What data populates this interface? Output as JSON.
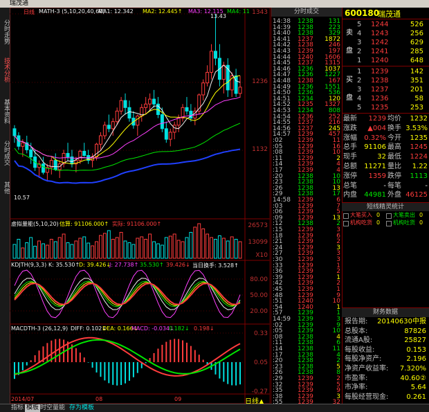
{
  "window": {
    "title": "瑞茂通"
  },
  "side_tabs": [
    "分时走势",
    "技术分析",
    "基本资料",
    "分时成交",
    "其他"
  ],
  "main_chart": {
    "label": "日线",
    "ma_header": "MATH-3 (5,10,20,40,60)",
    "ma1": "MA1: 12.342",
    "ma2": "MA2: 12.445↑",
    "ma3": "MA3: 12.115",
    "ma4": "MA4: 11",
    "price_high_label": "13.43",
    "price_low_label": "10.57",
    "axis": [
      "1343",
      "1236",
      "1132"
    ]
  },
  "volume_panel": {
    "header": "虚拟量能(5,10,20)",
    "estimate": "估算: 91106.000↑",
    "actual": "实际: 91106.000↑",
    "axis": [
      "26573",
      "13099",
      "X10"
    ]
  },
  "kdj_panel": {
    "header": "KDJTH(9,3,3)",
    "k": "K: 35.530↑",
    "d": "D: 39.426↓",
    "j": "J: 27.738↑",
    "extra1": "35.530↑",
    "extra2": "39.426↓",
    "turnover": "当日换手: 3.528↑",
    "axis": [
      "80.00",
      "50.00",
      "20.00"
    ]
  },
  "macd_panel": {
    "header": "MACDTH-3 (26,12,9)",
    "diff": "DIFF: 0.102↓",
    "dea": "DEA: 0.166↓",
    "macd": "MACD: -0.034↓",
    "extra1": "0.182↓",
    "extra2": "0.198↓",
    "axis": [
      "0.33",
      "0.05",
      "-0.27"
    ]
  },
  "date_axis": [
    "2014/07",
    "08",
    "09"
  ],
  "period_button": "日线▲",
  "bottom_tabs": [
    "指标",
    "模板",
    "时空量能",
    "存为模板"
  ],
  "ticks_panel": {
    "title": "分时成交",
    "rows": [
      {
        "t": "14:38",
        "p": "1238",
        "d": "down",
        "v": "131"
      },
      {
        "t": "14:39",
        "p": "1238",
        "d": "down",
        "v": "223"
      },
      {
        "t": "14:40",
        "p": "1238",
        "d": "down",
        "v": "329"
      },
      {
        "t": "14:41",
        "p": "1237",
        "d": "up",
        "v": "1872"
      },
      {
        "t": "14:42",
        "p": "1238",
        "d": "up",
        "v": "246"
      },
      {
        "t": "14:43",
        "p": "1239",
        "d": "up",
        "v": "197"
      },
      {
        "t": "14:44",
        "p": "1240",
        "d": "up",
        "v": "1606"
      },
      {
        "t": "14:45",
        "p": "1237",
        "d": "up",
        "v": "1315"
      },
      {
        "t": "14:46",
        "p": "1236",
        "d": "down",
        "v": "1037"
      },
      {
        "t": "14:47",
        "p": "1236",
        "d": "down",
        "v": "1227"
      },
      {
        "t": "14:48",
        "p": "1238",
        "d": "up",
        "v": "167"
      },
      {
        "t": "14:49",
        "p": "1236",
        "d": "down",
        "v": "1551"
      },
      {
        "t": "14:50",
        "p": "1236",
        "d": "down",
        "v": "536"
      },
      {
        "t": "14:51",
        "p": "1234",
        "d": "down",
        "v": "120"
      },
      {
        "t": "14:52",
        "p": "1235",
        "d": "up",
        "v": "1327"
      },
      {
        "t": "14:53",
        "p": "1234",
        "d": "down",
        "v": "808"
      },
      {
        "t": "14:54",
        "p": "1236",
        "d": "up",
        "v": "252"
      },
      {
        "t": "14:55",
        "p": "1237",
        "d": "up",
        "v": "216"
      },
      {
        "t": "14:56",
        "p": "1237",
        "d": "up",
        "v": "245"
      },
      {
        "t": "14:57",
        "p": "1239",
        "d": "up",
        "v": "457"
      },
      {
        "t": ":02",
        "p": "1239",
        "d": "up",
        "v": "11"
      },
      {
        "t": ":05",
        "p": "1239",
        "d": "up",
        "v": "16"
      },
      {
        "t": ":08",
        "p": "1239",
        "d": "up",
        "v": "10"
      },
      {
        "t": ":11",
        "p": "1239",
        "d": "up",
        "v": "2"
      },
      {
        "t": ":14",
        "p": "1239",
        "d": "up",
        "v": "4"
      },
      {
        "t": ":17",
        "p": "1239",
        "d": "up",
        "v": "4"
      },
      {
        "t": ":20",
        "p": "1238",
        "d": "down",
        "v": "10"
      },
      {
        "t": ":23",
        "p": "1238",
        "d": "down",
        "v": "10"
      },
      {
        "t": ":26",
        "p": "1238",
        "d": "down",
        "v": "13"
      },
      {
        "t": ":29",
        "p": "1238",
        "d": "down",
        "v": "17"
      },
      {
        "t": "14:58",
        "p": "1239",
        "d": "up",
        "v": "6"
      },
      {
        "t": ":03",
        "p": "1239",
        "d": "up",
        "v": "7"
      },
      {
        "t": ":06",
        "p": "1239",
        "d": "up",
        "v": "5"
      },
      {
        "t": ":09",
        "p": "1239",
        "d": "up",
        "v": "13"
      },
      {
        "t": ":12",
        "p": "1238",
        "d": "down",
        "v": "2"
      },
      {
        "t": ":15",
        "p": "1239",
        "d": "up",
        "v": "3"
      },
      {
        "t": ":18",
        "p": "1239",
        "d": "up",
        "v": "6"
      },
      {
        "t": ":21",
        "p": "1239",
        "d": "up",
        "v": "2"
      },
      {
        "t": ":24",
        "p": "1239",
        "d": "up",
        "v": "3"
      },
      {
        "t": ":27",
        "p": "1239",
        "d": "up",
        "v": "3"
      },
      {
        "t": ":30",
        "p": "1239",
        "d": "up",
        "v": "3"
      },
      {
        "t": ":33",
        "p": "1239",
        "d": "up",
        "v": "1"
      },
      {
        "t": ":36",
        "p": "1239",
        "d": "up",
        "v": "2"
      },
      {
        "t": ":39",
        "p": "1239",
        "d": "up",
        "v": "1"
      },
      {
        "t": ":42",
        "p": "1239",
        "d": "up",
        "v": "2"
      },
      {
        "t": ":45",
        "p": "1239",
        "d": "up",
        "v": "1"
      },
      {
        "t": ":48",
        "p": "1239",
        "d": "up",
        "v": "9"
      },
      {
        "t": ":51",
        "p": "1240",
        "d": "up",
        "v": "10"
      },
      {
        "t": ":54",
        "p": "1240",
        "d": "up",
        "v": "1"
      },
      {
        "t": ":57",
        "p": "1239",
        "d": "down",
        "v": "1"
      },
      {
        "t": "14:59",
        "p": "1239",
        "d": "down",
        "v": "3"
      },
      {
        "t": ":02",
        "p": "1239",
        "d": "down",
        "v": "9"
      },
      {
        "t": ":05",
        "p": "1239",
        "d": "down",
        "v": "10"
      },
      {
        "t": ":08",
        "p": "1238",
        "d": "down",
        "v": "4"
      },
      {
        "t": ":11",
        "p": "1238",
        "d": "down",
        "v": "6"
      },
      {
        "t": ":14",
        "p": "1238",
        "d": "down",
        "v": "11"
      },
      {
        "t": ":17",
        "p": "1238",
        "d": "down",
        "v": "4"
      },
      {
        "t": ":20",
        "p": "1238",
        "d": "down",
        "v": "2"
      },
      {
        "t": ":23",
        "p": "1238",
        "d": "down",
        "v": "5"
      },
      {
        "t": ":26",
        "p": "1238",
        "d": "down",
        "v": "8"
      },
      {
        "t": ":29",
        "p": "1239",
        "d": "up",
        "v": "2"
      },
      {
        "t": ":32",
        "p": "1239",
        "d": "up",
        "v": "5"
      },
      {
        "t": ":35",
        "p": "1239",
        "d": "up",
        "v": "9"
      },
      {
        "t": ":38",
        "p": "1239",
        "d": "up",
        "v": "3"
      },
      {
        "t": ":55",
        "p": "1239",
        "d": "up",
        "v": "32"
      }
    ]
  },
  "quote": {
    "code": "600180",
    "name": "瑞茂通",
    "sell_label": [
      "卖",
      "盘"
    ],
    "buy_label": [
      "买",
      "盘"
    ],
    "asks": [
      {
        "n": "5",
        "p": "1244",
        "v": "526"
      },
      {
        "n": "4",
        "p": "1243",
        "v": "256"
      },
      {
        "n": "3",
        "p": "1242",
        "v": "629"
      },
      {
        "n": "2",
        "p": "1241",
        "v": "285"
      },
      {
        "n": "1",
        "p": "1240",
        "v": "648"
      }
    ],
    "bids": [
      {
        "n": "1",
        "p": "1239",
        "v": "142"
      },
      {
        "n": "2",
        "p": "1238",
        "v": "351"
      },
      {
        "n": "3",
        "p": "1237",
        "v": "201"
      },
      {
        "n": "4",
        "p": "1236",
        "v": "58"
      },
      {
        "n": "5",
        "p": "1235",
        "v": "253"
      }
    ],
    "stats": [
      {
        "k1": "最新",
        "v1": "1239",
        "k2": "均价",
        "v2": "1232"
      },
      {
        "k1": "涨跌",
        "v1": "▲004",
        "k2": "换手",
        "v2": "3.53%"
      },
      {
        "k1": "涨幅",
        "v1": "0.32%",
        "k2": "今开",
        "v2": "1235"
      },
      {
        "k1": "总手",
        "v1": "91106",
        "k2": "最高",
        "v2": "1245"
      },
      {
        "k1": "现手",
        "v1": "32",
        "k2": "最低",
        "v2": "1224"
      },
      {
        "k1": "总额",
        "v1": "11271",
        "k2": "量比",
        "v2": "1.22"
      },
      {
        "k1": "涨停",
        "v1": "1359",
        "k2": "跌停",
        "v2": "1113"
      },
      {
        "k1": "总笔",
        "v1": "-",
        "k2": "每笔",
        "v2": "-"
      },
      {
        "k1": "内盘",
        "v1": "44981",
        "k2": "外盘",
        "v2": "46125"
      }
    ],
    "sprite_title": "短线精灵统计",
    "sprite_items": [
      "大笔买入",
      "大笔卖出",
      "机构吃货",
      "机构吐货"
    ],
    "sprite_counts": [
      "0",
      "0",
      "0",
      "0"
    ],
    "fin_title": "财务数据",
    "fin_rows": [
      {
        "k": "报告期:",
        "v": "20140630中报"
      },
      {
        "k": "总股本:",
        "v": "87826"
      },
      {
        "k": "流通A股:",
        "v": "25827"
      },
      {
        "k": "每股收益:",
        "v": "0.153"
      },
      {
        "k": "每股净资产:",
        "v": "2.196"
      },
      {
        "k": "净资产收益率:",
        "v": "7.320%"
      },
      {
        "k": "市盈率:",
        "v": "40.60②"
      },
      {
        "k": "市净率:",
        "v": "5.64"
      },
      {
        "k": "每股经营现金:",
        "v": "0.261"
      }
    ]
  },
  "colors": {
    "up": "#ff3c3c",
    "down": "#00e600",
    "axis": "#800000",
    "bg": "#000000"
  }
}
